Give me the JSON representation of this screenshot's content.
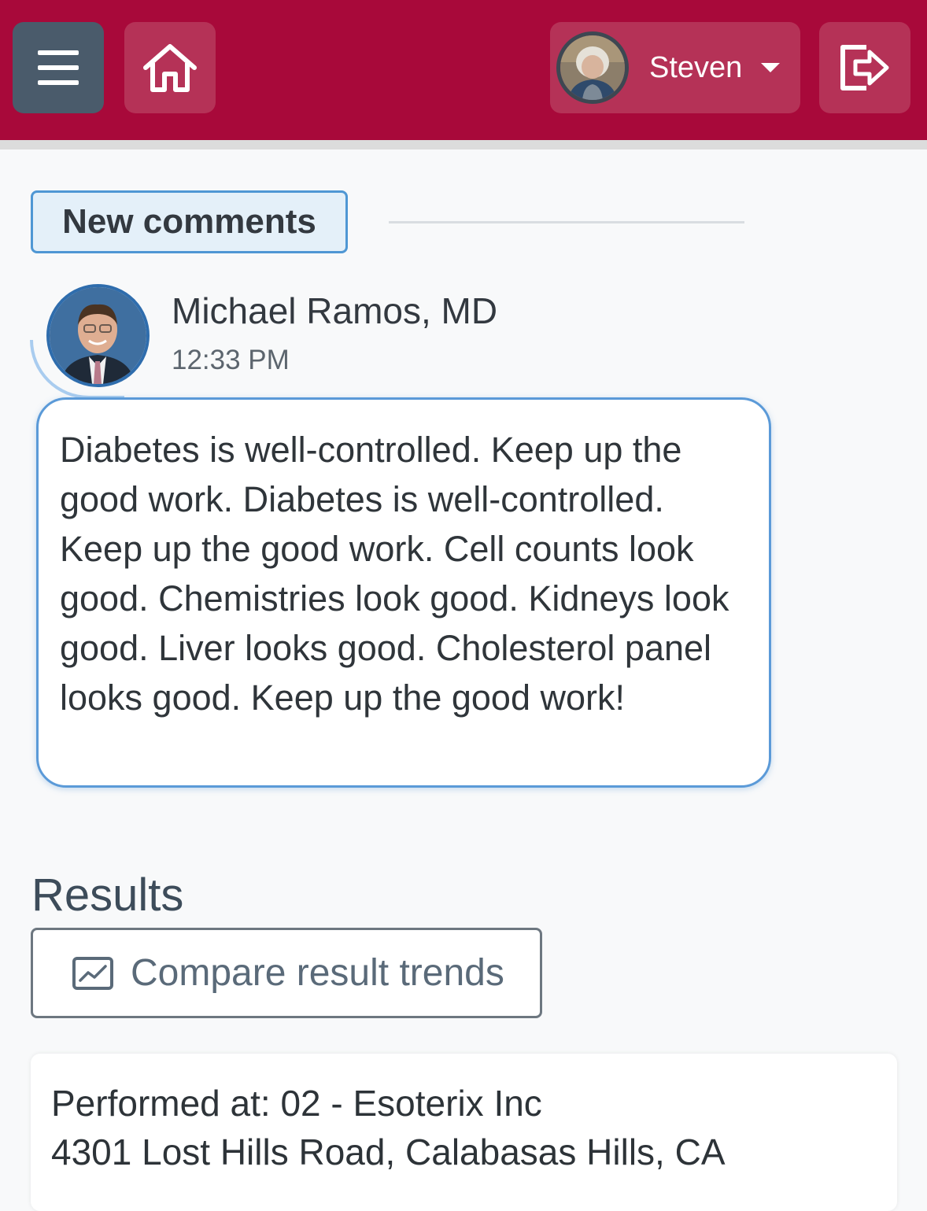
{
  "header": {
    "menu_icon": "hamburger-menu-icon",
    "home_icon": "home-icon",
    "user": {
      "name": "Steven",
      "avatar": "user-avatar",
      "dropdown_icon": "caret-down-icon"
    },
    "logout_icon": "sign-out-icon",
    "colors": {
      "brand": "#a8093a",
      "menu_button": "#4a5b6b"
    }
  },
  "comments": {
    "section_label": "New comments",
    "items": [
      {
        "author": "Michael Ramos, MD",
        "time": "12:33 PM",
        "text": "Diabetes is well-controlled. Keep up the good work. Diabetes is well-controlled. Keep up the good work. Cell counts look good. Chemistries look good. Kidneys look good. Liver looks good. Cholesterol panel looks good. Keep up the good work!"
      }
    ]
  },
  "results": {
    "title": "Results",
    "compare_button": "Compare result trends",
    "compare_icon": "line-chart-icon",
    "performed_at": "Performed at: 02 - Esoterix Inc",
    "address": "4301 Lost Hills Road, Calabasas Hills, CA"
  }
}
